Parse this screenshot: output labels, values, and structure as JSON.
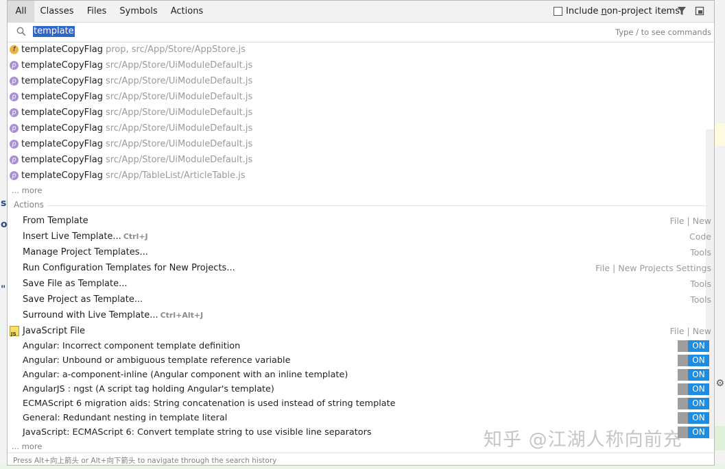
{
  "tabs": [
    "All",
    "Classes",
    "Files",
    "Symbols",
    "Actions"
  ],
  "include_non_project": {
    "prefix": "Include ",
    "underlined": "n",
    "suffix": "on-project items"
  },
  "search": {
    "value": "template",
    "hint": "Type / to see commands"
  },
  "symbol_results": [
    {
      "icon": "f",
      "name": "templateCopyFlag",
      "path": "prop, src/App/Store/AppStore.js"
    },
    {
      "icon": "p",
      "name": "templateCopyFlag",
      "path": "src/App/Store/UiModuleDefault.js"
    },
    {
      "icon": "p",
      "name": "templateCopyFlag",
      "path": "src/App/Store/UiModuleDefault.js"
    },
    {
      "icon": "p",
      "name": "templateCopyFlag",
      "path": "src/App/Store/UiModuleDefault.js"
    },
    {
      "icon": "p",
      "name": "templateCopyFlag",
      "path": "src/App/Store/UiModuleDefault.js"
    },
    {
      "icon": "p",
      "name": "templateCopyFlag",
      "path": "src/App/Store/UiModuleDefault.js"
    },
    {
      "icon": "p",
      "name": "templateCopyFlag",
      "path": "src/App/Store/UiModuleDefault.js"
    },
    {
      "icon": "p",
      "name": "templateCopyFlag",
      "path": "src/App/Store/UiModuleDefault.js"
    },
    {
      "icon": "p",
      "name": "templateCopyFlag",
      "path": "src/App/TableList/ArticleTable.js"
    }
  ],
  "more_label": "... more",
  "actions_section": "Actions",
  "actions": [
    {
      "label": "From Template",
      "shortcut": "",
      "category": "File | New"
    },
    {
      "label": "Insert Live Template...",
      "shortcut": "Ctrl+J",
      "category": "Code"
    },
    {
      "label": "Manage Project Templates...",
      "shortcut": "",
      "category": "Tools"
    },
    {
      "label": "Run Configuration Templates for New Projects...",
      "shortcut": "",
      "category": "File | New Projects Settings"
    },
    {
      "label": "Save File as Template...",
      "shortcut": "",
      "category": "Tools"
    },
    {
      "label": "Save Project as Template...",
      "shortcut": "",
      "category": "Tools"
    },
    {
      "label": "Surround with Live Template...",
      "shortcut": "Ctrl+Alt+J",
      "category": ""
    },
    {
      "label": "JavaScript File",
      "shortcut": "",
      "category": "File | New",
      "icon": "js-file-icon"
    }
  ],
  "inspections": [
    {
      "label": "Angular: Incorrect component template definition",
      "state": "ON"
    },
    {
      "label": "Angular: Unbound or ambiguous template reference variable",
      "state": "ON"
    },
    {
      "label": "Angular: a-component-inline (Angular component with an inline template)",
      "state": "ON"
    },
    {
      "label": "AngularJS : ngst (A script tag holding Angular's template)",
      "state": "ON"
    },
    {
      "label": "ECMAScript 6 migration aids: String concatenation is used instead of string template",
      "state": "ON"
    },
    {
      "label": "General: Redundant nesting in template literal",
      "state": "ON"
    },
    {
      "label": "JavaScript: ECMAScript 6: Convert template string to use visible line separators",
      "state": "ON"
    }
  ],
  "footer_hint": "Press Alt+向上箭头 or Alt+向下箭头 to navigate through the search history",
  "watermark": "知乎 @江湖人称向前充",
  "colors": {
    "selection": "#2f65ca",
    "toggle_on": "#1e8ce0",
    "property_icon": "#a98fd6",
    "function_icon": "#e8b54a"
  }
}
